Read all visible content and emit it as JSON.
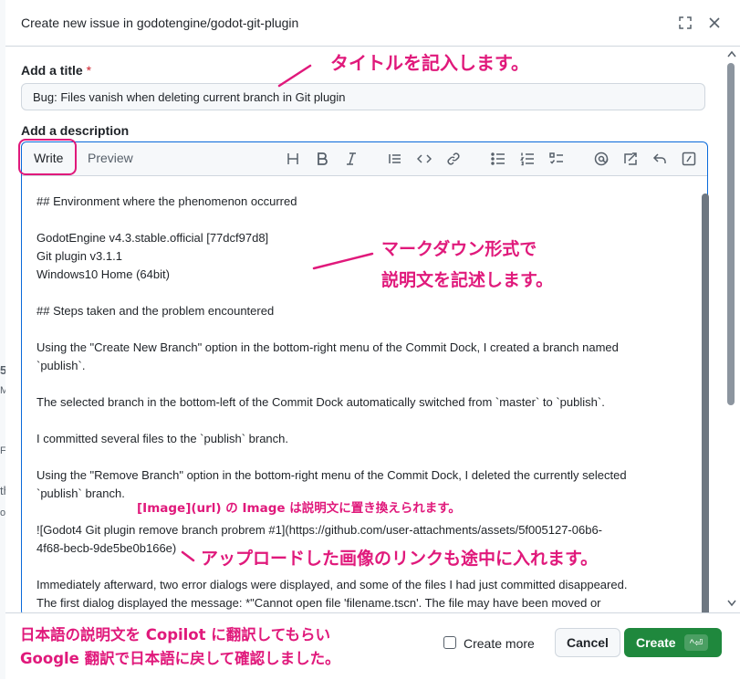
{
  "dialog": {
    "title": "Create new issue in godotengine/godot-git-plugin",
    "title_label": "Add a title",
    "required_mark": "*",
    "title_value": "Bug: Files vanish when deleting current branch in Git plugin",
    "description_label": "Add a description"
  },
  "editor": {
    "tabs": [
      {
        "label": "Write"
      },
      {
        "label": "Preview"
      }
    ],
    "toolbar_icons": [
      "heading-icon",
      "bold-icon",
      "italic-icon",
      "quote-icon",
      "code-icon",
      "link-icon",
      "unordered-list-icon",
      "ordered-list-icon",
      "task-list-icon",
      "mention-icon",
      "reference-icon",
      "reply-icon",
      "slash-command-icon"
    ],
    "lines": [
      "## Environment where the phenomenon occurred",
      "",
      "GodotEngine v4.3.stable.official [77dcf97d8]",
      "Git plugin v3.1.1",
      "Windows10 Home (64bit)",
      "",
      "## Steps taken and the problem encountered",
      "",
      "Using the \"Create New Branch\" option in the bottom-right menu of the Commit Dock, I created a branch named",
      "`publish`.",
      "",
      "The selected branch in the bottom-left of the Commit Dock automatically switched from `master` to `publish`.",
      "",
      "I committed several files to the `publish` branch.",
      "",
      "Using the \"Remove Branch\" option in the bottom-right menu of the Commit Dock, I deleted the currently selected",
      "`publish` branch.",
      "",
      "![Godot4 Git plugin remove branch probrem #1](https://github.com/user-attachments/assets/5f005127-06b6-",
      "4f68-becb-9de5be0b166e)",
      "",
      "Immediately afterward, two error dialogs were displayed, and some of the files I had just committed disappeared.",
      "The first dialog displayed the message: *\"Cannot open file 'filename.tscn'. The file may have been moved or"
    ]
  },
  "footer": {
    "create_more_label": "Create more",
    "cancel_label": "Cancel",
    "create_label": "Create",
    "create_shortcut": "^⏎"
  },
  "annotations": {
    "title_note": "タイトルを記入します。",
    "markdown_note_line1": "マークダウン形式で",
    "markdown_note_line2": "説明文を記述します。",
    "image_note": "[Image](url) の Image は説明文に置き換えられます。",
    "link_note": "アップロードした画像のリンクも途中に入れます。",
    "bottom_note_line1": "日本語の説明文を Copilot に翻訳してもらい",
    "bottom_note_line2": "Google 翻訳で日本語に戻して確認しました。"
  },
  "background": {
    "left_edge_fragments": [
      "5",
      "M",
      "Fe",
      "th",
      "oc"
    ]
  },
  "colors": {
    "accent": "#0969da",
    "primary_button": "#1f883d",
    "annotation": "#e0197b",
    "required": "#cf222e"
  }
}
